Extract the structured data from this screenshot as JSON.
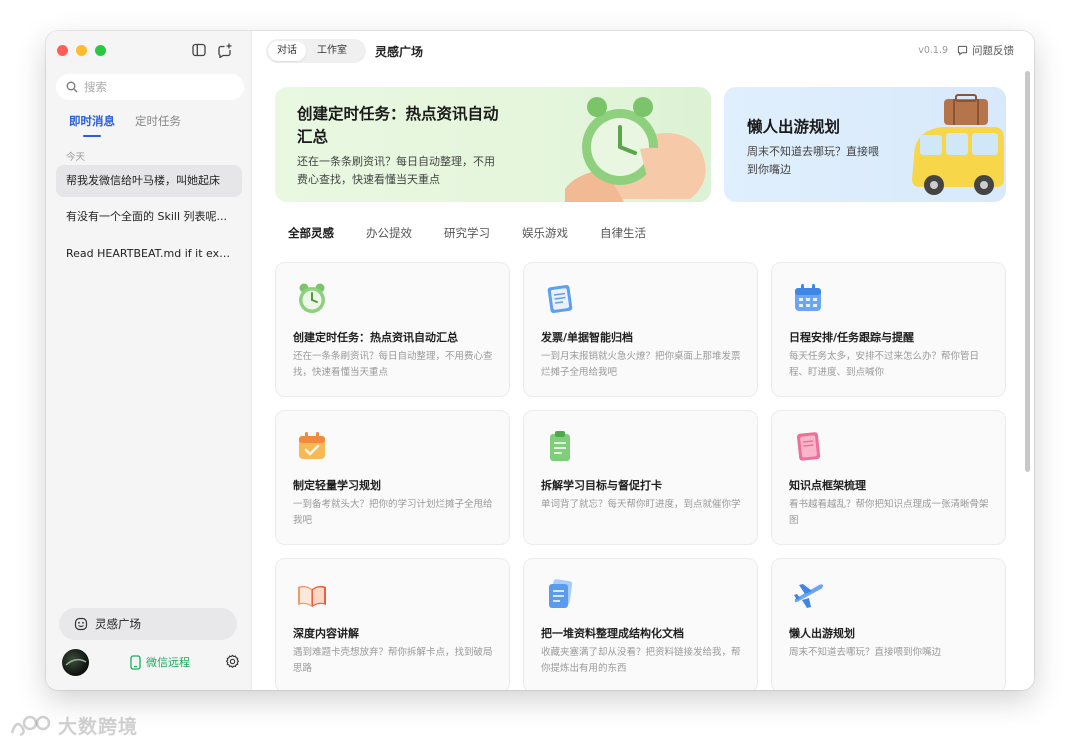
{
  "sidebar": {
    "search_placeholder": "搜索",
    "tabs": [
      {
        "label": "即时消息"
      },
      {
        "label": "定时任务"
      }
    ],
    "section_today": "今天",
    "conversations": [
      {
        "title": "帮我发微信给叶马楼，叫她起床"
      },
      {
        "title": "有没有一个全面的 Skill 列表呢..."
      },
      {
        "title": "Read HEARTBEAT.md if it exi..."
      }
    ],
    "inspire_button": "灵感广场",
    "wechat_remote": "微信远程"
  },
  "topbar": {
    "segments": [
      "对话",
      "工作室"
    ],
    "title": "灵感广场",
    "version": "v0.1.9",
    "feedback": "问题反馈"
  },
  "banners": [
    {
      "title": "创建定时任务：热点资讯自动汇总",
      "desc": "还在一条条刷资讯？每日自动整理，不用费心查找，快速看懂当天重点",
      "icon": "alarm-clock-hand"
    },
    {
      "title": "懒人出游规划",
      "desc": "周末不知道去哪玩？直接喂到你嘴边",
      "icon": "travel-van"
    }
  ],
  "categories": [
    "全部灵感",
    "办公提效",
    "研究学习",
    "娱乐游戏",
    "自律生活"
  ],
  "cards": [
    {
      "title": "创建定时任务：热点资讯自动汇总",
      "desc": "还在一条条刷资讯？每日自动整理，不用费心查找，快速看懂当天重点",
      "icon": "alarm-clock-icon"
    },
    {
      "title": "发票/单据智能归档",
      "desc": "一到月末报销就火急火燎？把你桌面上那堆发票烂摊子全甩给我吧",
      "icon": "document-icon"
    },
    {
      "title": "日程安排/任务跟踪与提醒",
      "desc": "每天任务太多，安排不过来怎么办？帮你管日程、盯进度、到点喊你",
      "icon": "calendar-icon"
    },
    {
      "title": "制定轻量学习规划",
      "desc": "一到备考就头大？把你的学习计划烂摊子全甩给我吧",
      "icon": "calendar-check-icon"
    },
    {
      "title": "拆解学习目标与督促打卡",
      "desc": "单词背了就忘？每天帮你盯进度，到点就催你学",
      "icon": "clipboard-icon"
    },
    {
      "title": "知识点框架梳理",
      "desc": "看书越看越乱？帮你把知识点理成一张清晰骨架图",
      "icon": "notebook-icon"
    },
    {
      "title": "深度内容讲解",
      "desc": "遇到难题卡壳想放弃？帮你拆解卡点，找到破局思路",
      "icon": "open-book-icon"
    },
    {
      "title": "把一堆资料整理成结构化文档",
      "desc": "收藏夹塞满了却从没看？把资料链接发给我，帮你提炼出有用的东西",
      "icon": "stacked-docs-icon"
    },
    {
      "title": "懒人出游规划",
      "desc": "周末不知道去哪玩？直接喂到你嘴边",
      "icon": "airplane-icon"
    }
  ],
  "colors": {
    "accent": "#2b5fd9",
    "wechat": "#1aad5a"
  },
  "watermark": "大数跨境"
}
